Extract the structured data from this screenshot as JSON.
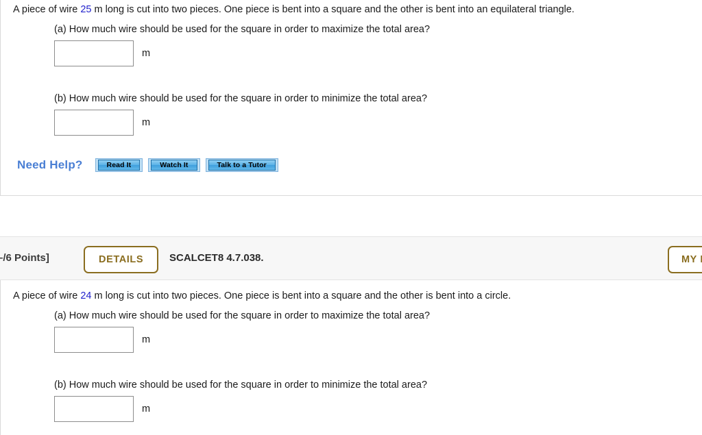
{
  "page": {
    "background": "#ffffff",
    "accent_blue": "#2222cc",
    "accent_amber": "#8a6d1f",
    "help_blue": "#4a7fd4"
  },
  "questions": [
    {
      "id": "question-1",
      "prompt_before": "A piece of wire ",
      "prompt_number": "25",
      "prompt_after": " m long is cut into two pieces. One piece is bent into a square and the other is bent into an equilateral triangle.",
      "parts": [
        {
          "label": "(a) How much wire should be used for the square in order to maximize the total area?",
          "answer_value": "",
          "answer_placeholder": "",
          "unit": "m"
        },
        {
          "label": "(b) How much wire should be used for the square in order to minimize the total area?",
          "answer_value": "",
          "answer_placeholder": "",
          "unit": "m"
        }
      ],
      "need_help": {
        "label": "Need Help?",
        "buttons": [
          {
            "label": "Read It"
          },
          {
            "label": "Watch It"
          },
          {
            "label": "Talk to a Tutor"
          }
        ]
      }
    },
    {
      "id": "question-2",
      "header": {
        "points": "–/6 Points]",
        "details_label": "DETAILS",
        "question_code": "SCALCET8 4.7.038.",
        "my_notes_label": "MY NOTES"
      },
      "prompt_before": "A piece of wire ",
      "prompt_number": "24",
      "prompt_after": " m long is cut into two pieces. One piece is bent into a square and the other is bent into a circle.",
      "parts": [
        {
          "label": "(a) How much wire should be used for the square in order to maximize the total area?",
          "answer_value": "",
          "answer_placeholder": "",
          "unit": "m"
        },
        {
          "label": "(b) How much wire should be used for the square in order to minimize the total area?",
          "answer_value": "",
          "answer_placeholder": "",
          "unit": "m"
        }
      ]
    }
  ]
}
